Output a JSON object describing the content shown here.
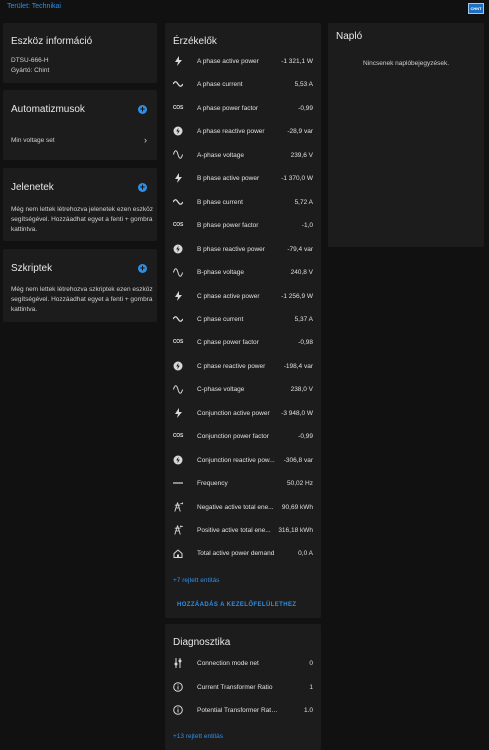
{
  "header": {
    "breadcrumb": "Terület: Technikai",
    "logo_text": "CHNT"
  },
  "device_info": {
    "title": "Eszköz információ",
    "model": "DTSU-666-H",
    "manufacturer": "Gyártó: Chint"
  },
  "automations": {
    "title": "Automatizmusok",
    "items": [
      {
        "label": "Min voltage set"
      }
    ]
  },
  "scenes": {
    "title": "Jelenetek",
    "empty_text": "Még nem lettek létrehozva jelenetek ezen eszköz segítségével. Hozzáadhat egyet a fenti + gombra kattintva."
  },
  "scripts": {
    "title": "Szkriptek",
    "empty_text": "Még nem lettek létrehozva szkriptek ezen eszköz segítségével. Hozzáadhat egyet a fenti + gombra kattintva."
  },
  "sensors": {
    "title": "Érzékelők",
    "rows": [
      {
        "icon": "flash-icon",
        "label": "A phase active power",
        "value": "-1 321,1 W"
      },
      {
        "icon": "current-ac-icon",
        "label": "A phase current",
        "value": "5,53 A"
      },
      {
        "icon": "cos-icon",
        "label": "A phase power factor",
        "value": "-0,99"
      },
      {
        "icon": "reactive-power-icon",
        "label": "A phase reactive power",
        "value": "-28,9 var"
      },
      {
        "icon": "sine-wave-icon",
        "label": "A-phase voltage",
        "value": "239,6 V"
      },
      {
        "icon": "flash-icon",
        "label": "B phase active power",
        "value": "-1 370,0 W"
      },
      {
        "icon": "current-ac-icon",
        "label": "B phase current",
        "value": "5,72 A"
      },
      {
        "icon": "cos-icon",
        "label": "B phase power factor",
        "value": "-1,0"
      },
      {
        "icon": "reactive-power-icon",
        "label": "B phase reactive power",
        "value": "-79,4 var"
      },
      {
        "icon": "sine-wave-icon",
        "label": "B-phase voltage",
        "value": "240,8 V"
      },
      {
        "icon": "flash-icon",
        "label": "C phase active power",
        "value": "-1 256,9 W"
      },
      {
        "icon": "current-ac-icon",
        "label": "C phase current",
        "value": "5,37 A"
      },
      {
        "icon": "cos-icon",
        "label": "C phase power factor",
        "value": "-0,98"
      },
      {
        "icon": "reactive-power-icon",
        "label": "C phase reactive power",
        "value": "-198,4 var"
      },
      {
        "icon": "sine-wave-icon",
        "label": "C-phase voltage",
        "value": "238,0 V"
      },
      {
        "icon": "flash-icon",
        "label": "Conjunction active power",
        "value": "-3 948,0 W"
      },
      {
        "icon": "cos-icon",
        "label": "Conjunction power factor",
        "value": "-0,99"
      },
      {
        "icon": "reactive-power-icon",
        "label": "Conjunction reactive pow...",
        "value": "-306,8 var"
      },
      {
        "icon": "frequency-icon",
        "label": "Frequency",
        "value": "50,02 Hz"
      },
      {
        "icon": "transmission-tower-export-icon",
        "label": "Negative active total ene...",
        "value": "90,69 kWh"
      },
      {
        "icon": "transmission-tower-import-icon",
        "label": "Positive active total ene...",
        "value": "316,18 kWh"
      },
      {
        "icon": "home-icon",
        "label": "Total active power demand",
        "value": "0,0 A"
      }
    ],
    "hidden_link": "+7 rejtett entitás",
    "add_button": "HOZZÁADÁS A KEZELŐFELÜLETHEZ"
  },
  "diagnostics": {
    "title": "Diagnosztika",
    "rows": [
      {
        "icon": "connection-icon",
        "label": "Connection mode net",
        "value": "0"
      },
      {
        "icon": "info-icon",
        "label": "Current Transformer Ratio",
        "value": "1"
      },
      {
        "icon": "info-icon",
        "label": "Potential Transformer Ratio(*)",
        "value": "1.0"
      }
    ],
    "hidden_link": "+13 rejtett entitás"
  },
  "log": {
    "title": "Napló",
    "empty_text": "Nincsenek naplóbejegyzések."
  },
  "colors": {
    "background": "#111111",
    "card": "#1c1c1c",
    "accent": "#2f8fe8",
    "text": "#e1e1e1"
  }
}
